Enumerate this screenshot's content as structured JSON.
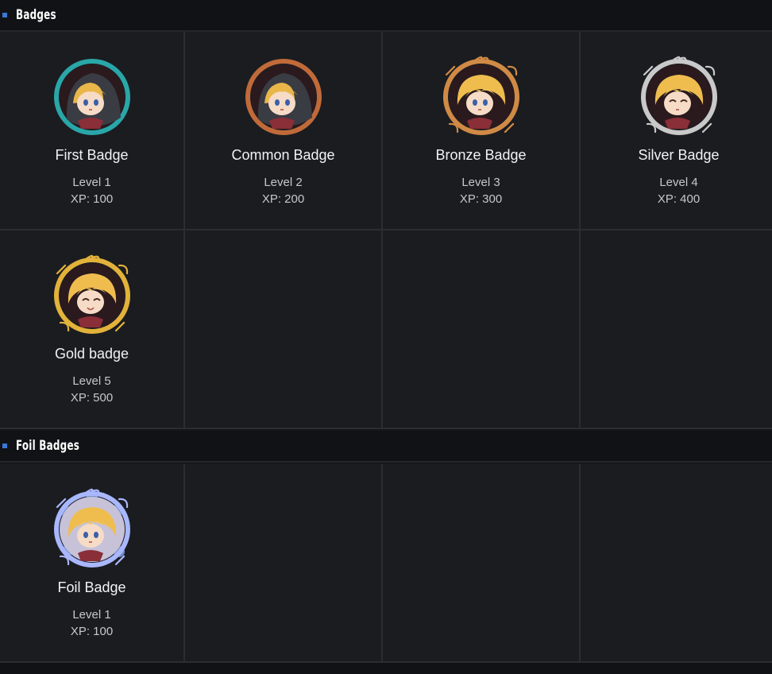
{
  "sections": [
    {
      "title": "Badges",
      "badges": [
        {
          "name": "First Badge",
          "level": "Level 1",
          "xp": "XP: 100",
          "frame": "teal",
          "face": "hooded"
        },
        {
          "name": "Common Badge",
          "level": "Level 2",
          "xp": "XP: 200",
          "frame": "copper",
          "face": "hooded"
        },
        {
          "name": "Bronze Badge",
          "level": "Level 3",
          "xp": "XP: 300",
          "frame": "bronze",
          "face": "blonde"
        },
        {
          "name": "Silver Badge",
          "level": "Level 4",
          "xp": "XP: 400",
          "frame": "silver",
          "face": "blonde-wink"
        },
        {
          "name": "Gold badge",
          "level": "Level 5",
          "xp": "XP: 500",
          "frame": "gold",
          "face": "blonde-happy"
        }
      ]
    },
    {
      "title": "Foil Badges",
      "badges": [
        {
          "name": "Foil Badge",
          "level": "Level 1",
          "xp": "XP: 100",
          "frame": "foil",
          "face": "blonde"
        }
      ]
    }
  ],
  "colors": {
    "accent": "#3a77d8",
    "teal": "#2aa6a8",
    "copper": "#c06a3a",
    "bronze": "#d08a45",
    "silver": "#c9c9c9",
    "gold": "#e2b23a",
    "foil": "#a9b7ff"
  },
  "icons": {
    "section_bullet": "square-bullet-icon",
    "badge_portrait": "character-badge-icon"
  }
}
